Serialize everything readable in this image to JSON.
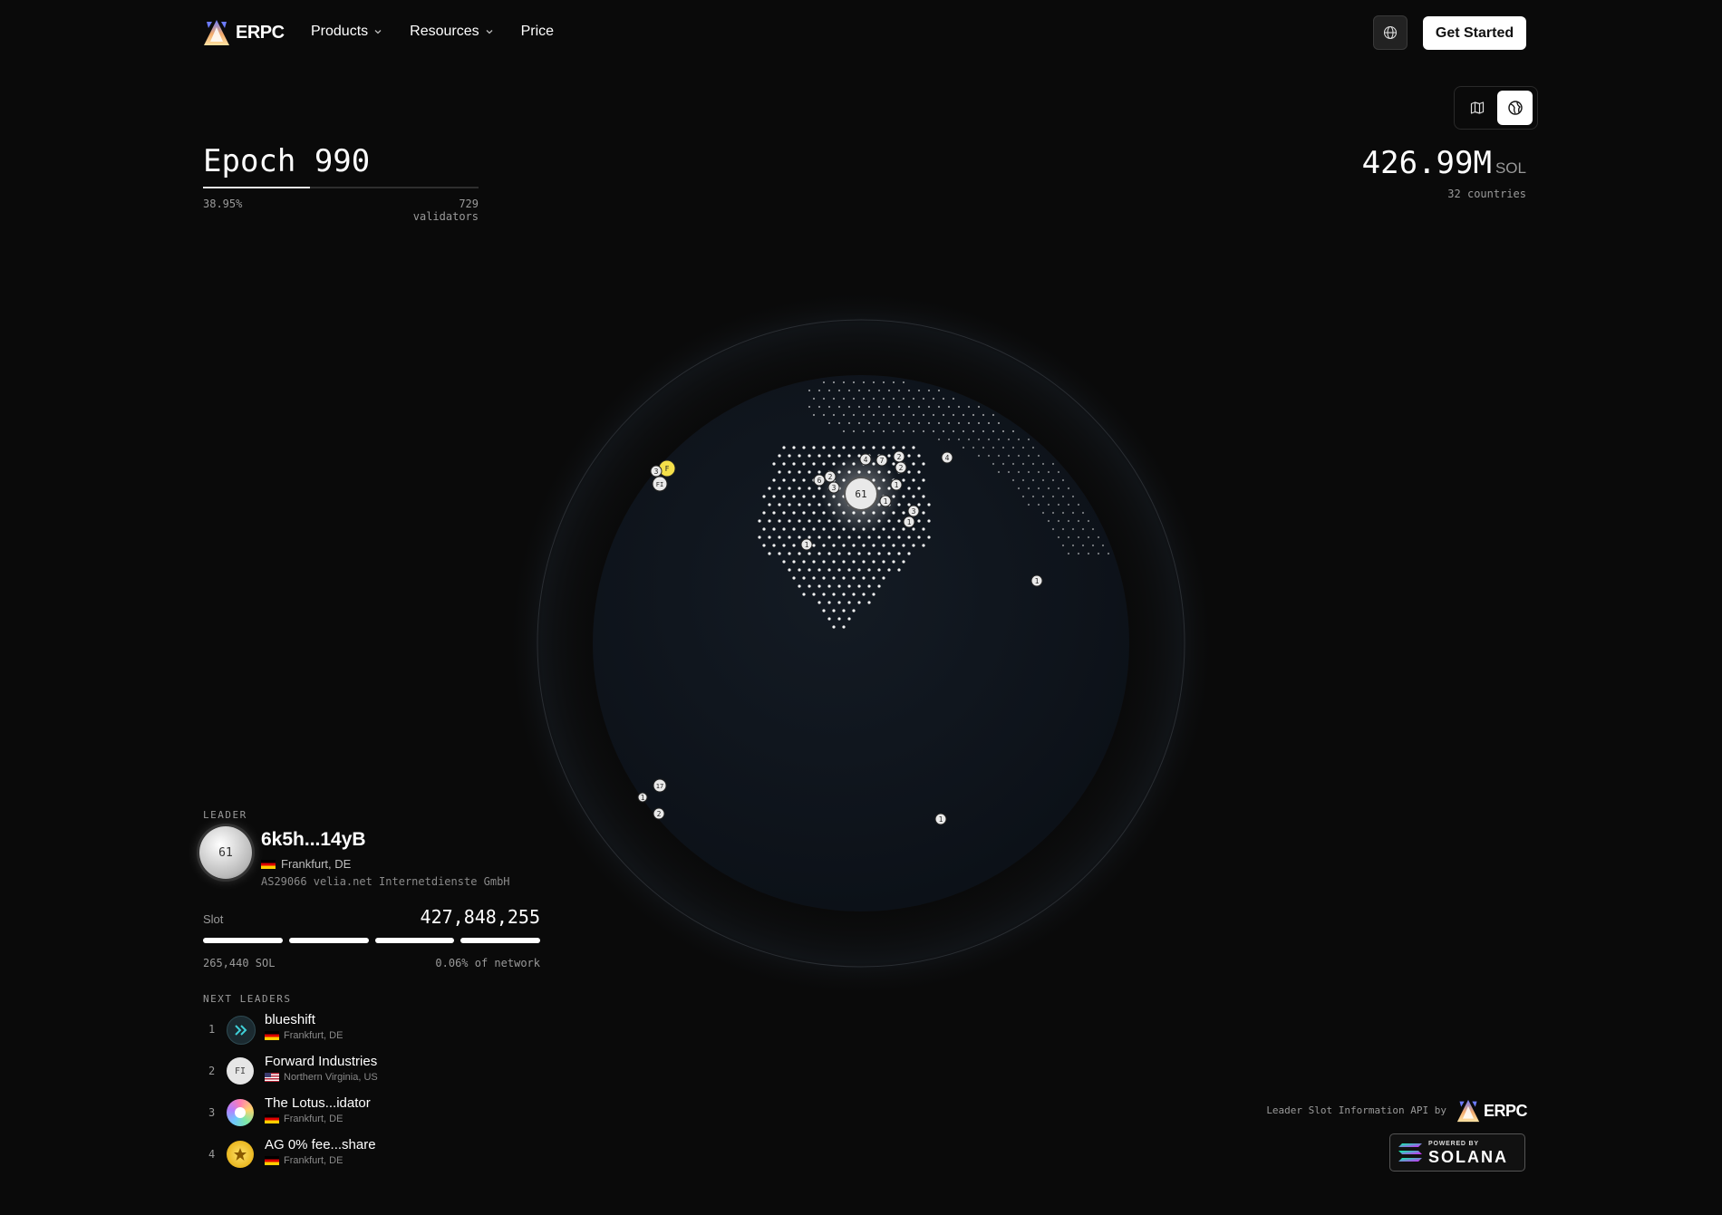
{
  "nav": {
    "brand": "ERPC",
    "items": [
      {
        "label": "Products",
        "has_dropdown": true
      },
      {
        "label": "Resources",
        "has_dropdown": true
      },
      {
        "label": "Price",
        "has_dropdown": false
      }
    ],
    "language_icon": "globe-icon",
    "cta_label": "Get Started"
  },
  "view_toggle": {
    "options": [
      {
        "icon": "map-icon",
        "active": false
      },
      {
        "icon": "globe-view-icon",
        "active": true
      }
    ]
  },
  "epoch": {
    "title": "Epoch 990",
    "progress_label": "38.95%",
    "progress_fraction": 0.3895,
    "validators": "729 validators"
  },
  "stake": {
    "value": "426.99M",
    "unit": "SOL",
    "countries": "32 countries"
  },
  "globe": {
    "clusters": [
      {
        "label": "61",
        "primary": true
      },
      {
        "label": "F",
        "highlight": true
      },
      {
        "label": "FI"
      },
      {
        "label": "3"
      },
      {
        "label": "4"
      },
      {
        "label": "7"
      },
      {
        "label": "2"
      },
      {
        "label": "2"
      },
      {
        "label": "4"
      },
      {
        "label": "6"
      },
      {
        "label": "2"
      },
      {
        "label": "3"
      },
      {
        "label": "1"
      },
      {
        "label": "1"
      },
      {
        "label": "3"
      },
      {
        "label": "1"
      },
      {
        "label": "1"
      },
      {
        "label": "1"
      },
      {
        "label": "17"
      },
      {
        "label": "2"
      },
      {
        "label": "1"
      },
      {
        "label": "1"
      }
    ]
  },
  "leader": {
    "section_label": "LEADER",
    "avatar_label": "61",
    "name": "6k5h...14yB",
    "location": "Frankfurt, DE",
    "asn": "AS29066 velia.net Internetdienste GmbH",
    "slot_label": "Slot",
    "slot_value": "427,848,255",
    "slot_bars_filled": 4,
    "stake_sol": "265,440 SOL",
    "network_share": "0.06% of network"
  },
  "next_leaders": {
    "section_label": "NEXT LEADERS",
    "items": [
      {
        "rank": "1",
        "name": "blueshift",
        "location": "Frankfurt, DE",
        "avatar": "blueshift-icon",
        "flag": "de"
      },
      {
        "rank": "2",
        "name": "Forward Industries",
        "location": "Northern Virginia, US",
        "avatar_text": "FI",
        "flag": "us"
      },
      {
        "rank": "3",
        "name": "The Lotus...idator",
        "location": "Frankfurt, DE",
        "avatar": "lotus-icon",
        "flag": "de"
      },
      {
        "rank": "4",
        "name": "AG 0% fee...share",
        "location": "Frankfurt, DE",
        "avatar": "ag-icon",
        "flag": "de"
      }
    ]
  },
  "footer": {
    "api_note": "Leader Slot Information API by",
    "brand": "ERPC",
    "badge_small": "POWERED BY",
    "badge_name": "SOLANA"
  },
  "colors": {
    "background": "#0a0a0a",
    "globe": "#0f141b",
    "highlight": "#f5e04a",
    "text": "#ffffff",
    "muted": "#9a9a9a"
  }
}
